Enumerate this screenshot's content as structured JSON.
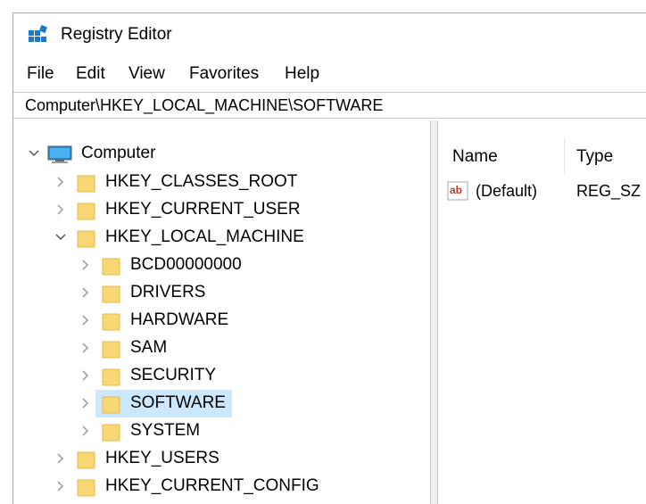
{
  "window": {
    "title": "Registry Editor"
  },
  "menu": [
    {
      "label": "File"
    },
    {
      "label": "Edit"
    },
    {
      "label": "View"
    },
    {
      "label": "Favorites"
    },
    {
      "label": "Help"
    }
  ],
  "address": {
    "path": "Computer\\HKEY_LOCAL_MACHINE\\SOFTWARE"
  },
  "tree": {
    "root": {
      "label": "Computer",
      "icon": "computer-icon",
      "expanded": true
    },
    "hives": [
      {
        "label": "HKEY_CLASSES_ROOT",
        "expanded": false
      },
      {
        "label": "HKEY_CURRENT_USER",
        "expanded": false
      },
      {
        "label": "HKEY_LOCAL_MACHINE",
        "expanded": true
      },
      {
        "label": "HKEY_USERS",
        "expanded": false
      },
      {
        "label": "HKEY_CURRENT_CONFIG",
        "expanded": false
      }
    ],
    "hklm_children": [
      {
        "label": "BCD00000000"
      },
      {
        "label": "DRIVERS"
      },
      {
        "label": "HARDWARE"
      },
      {
        "label": "SAM"
      },
      {
        "label": "SECURITY"
      },
      {
        "label": "SOFTWARE",
        "selected": true
      },
      {
        "label": "SYSTEM"
      }
    ]
  },
  "list": {
    "columns": [
      {
        "label": "Name"
      },
      {
        "label": "Type"
      }
    ],
    "rows": [
      {
        "name": "(Default)",
        "type": "REG_SZ",
        "icon": "string-value-icon"
      }
    ]
  },
  "colors": {
    "selection": "#cce8ff",
    "folder": "#f8d775",
    "folder_dark": "#e8b84a",
    "accent": "#1979ca"
  }
}
